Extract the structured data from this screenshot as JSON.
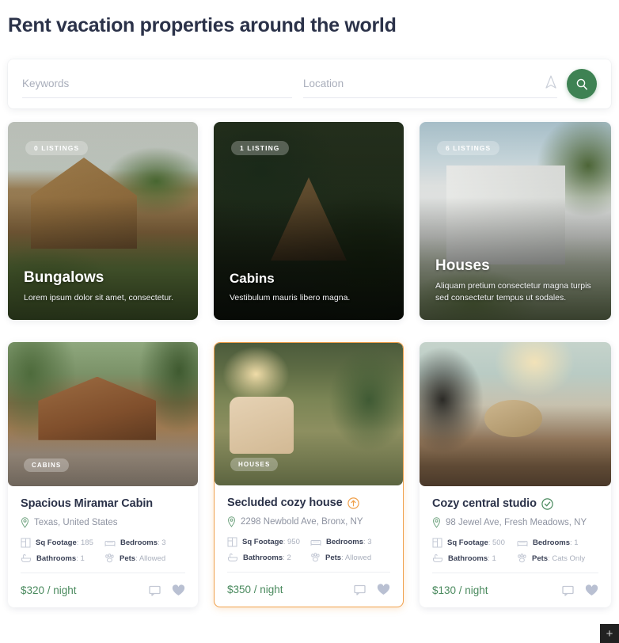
{
  "header": {
    "title": "Rent vacation properties around the world"
  },
  "search": {
    "keywords_placeholder": "Keywords",
    "keywords_value": "",
    "location_placeholder": "Location",
    "location_value": "",
    "locate_icon": "location-arrow-icon",
    "submit_icon": "search-icon",
    "accent_color": "#3e8253"
  },
  "categories": [
    {
      "badge": "0 LISTINGS",
      "title": "Bungalows",
      "description": "Lorem ipsum dolor sit amet, consectetur.",
      "image_alt": "bungalow-photo"
    },
    {
      "badge": "1 LISTING",
      "title": "Cabins",
      "description": "Vestibulum mauris libero magna.",
      "image_alt": "cabin-photo"
    },
    {
      "badge": "6 LISTINGS",
      "title": "Houses",
      "description": "Aliquam pretium consectetur magna turpis sed consectetur tempus ut sodales.",
      "image_alt": "houses-photo"
    }
  ],
  "properties": [
    {
      "tag": "CABINS",
      "title": "Spacious Miramar Cabin",
      "title_badge": "",
      "address": "Texas, United States",
      "meta": [
        {
          "label": "Sq Footage",
          "value": "185",
          "icon": "floorplan-icon"
        },
        {
          "label": "Bedrooms",
          "value": "3",
          "icon": "bed-icon"
        },
        {
          "label": "Bathrooms",
          "value": "1",
          "icon": "bathtub-icon"
        },
        {
          "label": "Pets",
          "value": "Allowed",
          "icon": "paw-icon"
        }
      ],
      "price": "$320 / night",
      "featured": false
    },
    {
      "tag": "HOUSES",
      "title": "Secluded cozy house",
      "title_badge": "featured-arrow-icon",
      "address": "2298 Newbold Ave, Bronx, NY",
      "meta": [
        {
          "label": "Sq Footage",
          "value": "950",
          "icon": "floorplan-icon"
        },
        {
          "label": "Bedrooms",
          "value": "3",
          "icon": "bed-icon"
        },
        {
          "label": "Bathrooms",
          "value": "2",
          "icon": "bathtub-icon"
        },
        {
          "label": "Pets",
          "value": "Allowed",
          "icon": "paw-icon"
        }
      ],
      "price": "$350 / night",
      "featured": true
    },
    {
      "tag": "",
      "title": "Cozy central studio",
      "title_badge": "verified-check-icon",
      "address": "98 Jewel Ave, Fresh Meadows, NY",
      "meta": [
        {
          "label": "Sq Footage",
          "value": "500",
          "icon": "floorplan-icon"
        },
        {
          "label": "Bedrooms",
          "value": "1",
          "icon": "bed-icon"
        },
        {
          "label": "Bathrooms",
          "value": "1",
          "icon": "bathtub-icon"
        },
        {
          "label": "Pets",
          "value": "Cats Only",
          "icon": "paw-icon"
        }
      ],
      "price": "$130 / night",
      "featured": false
    }
  ],
  "card_icons": {
    "message": "message-icon",
    "favorite": "heart-icon"
  },
  "fab": {
    "label": "+"
  },
  "colors": {
    "title": "#2b3249",
    "price_green": "#4a8a5e",
    "featured_orange": "#f0a04b",
    "verified_green": "#4a8a5e",
    "muted": "#8e93a1"
  }
}
